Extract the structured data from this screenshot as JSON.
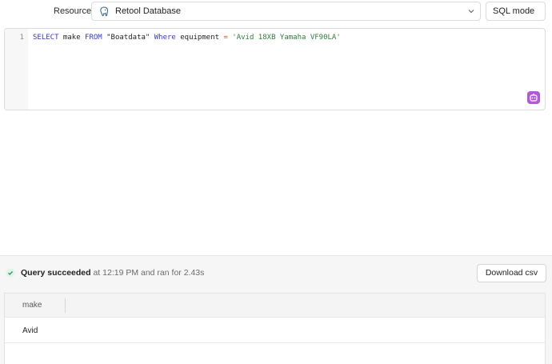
{
  "resource": {
    "label": "Resource",
    "selected": "Retool Database",
    "icon": "postgres-elephant-icon"
  },
  "mode": {
    "selected": "SQL mode"
  },
  "editor": {
    "line_number": "1",
    "tokens": {
      "t1": "SELECT",
      "t2": " make ",
      "t3": "FROM",
      "t4": " \"Boatdata\" ",
      "t5": "Where",
      "t6": " equipment ",
      "t7": "=",
      "t8": " ",
      "t9": "'Avid 18XB Yamaha VF90LA'"
    }
  },
  "status": {
    "label": "Query succeeded",
    "detail": " at 12:19 PM and ran for 2.43s"
  },
  "actions": {
    "download_label": "Download csv"
  },
  "table": {
    "columns": [
      "make"
    ],
    "rows": [
      [
        "Avid"
      ]
    ]
  },
  "colors": {
    "keyword": "#3a3ac4",
    "string": "#2f7d3c",
    "operator": "#c8531f",
    "success": "#2e9e5b",
    "ai_accent": "#b05ad8"
  }
}
